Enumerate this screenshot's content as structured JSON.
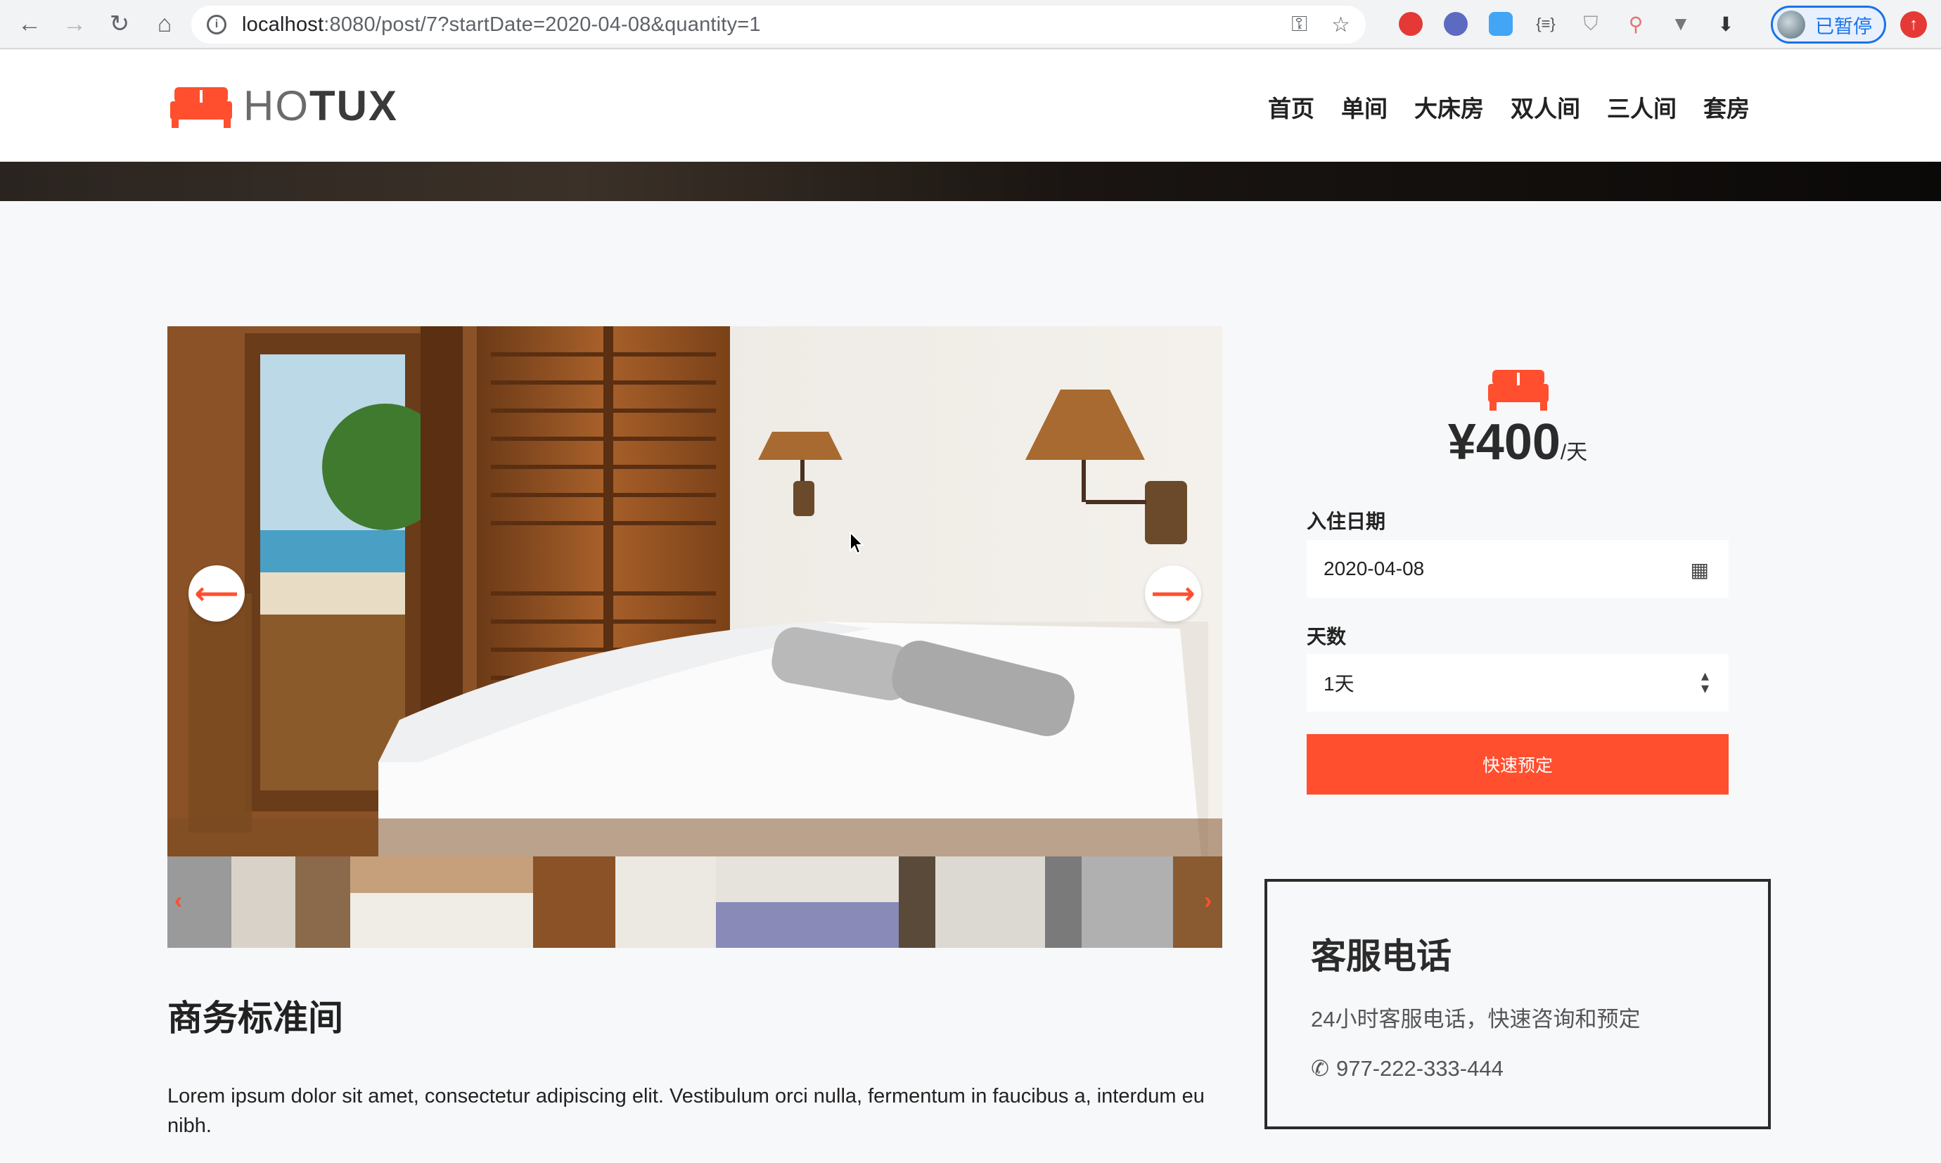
{
  "browser": {
    "url_host": "localhost",
    "url_path": ":8080/post/7?startDate=2020-04-08&quantity=1",
    "profile_label": "已暂停"
  },
  "site": {
    "logo_part1": "HO",
    "logo_part2": "TUX",
    "nav": [
      "首页",
      "单间",
      "大床房",
      "双人间",
      "三人间",
      "套房"
    ]
  },
  "room": {
    "title": "商务标准间",
    "description": "Lorem ipsum dolor sit amet, consectetur adipiscing elit. Vestibulum orci nulla, fermentum in faucibus a, interdum eu nibh."
  },
  "booking": {
    "price": "¥400",
    "price_unit": "/天",
    "checkin_label": "入住日期",
    "checkin_value": "2020-04-08",
    "days_label": "天数",
    "days_value": "1天",
    "submit_label": "快速预定"
  },
  "service": {
    "title": "客服电话",
    "description": "24小时客服电话，快速咨询和预定",
    "phone": "977-222-333-444"
  },
  "colors": {
    "accent": "#ff4f2f",
    "text": "#222222"
  }
}
